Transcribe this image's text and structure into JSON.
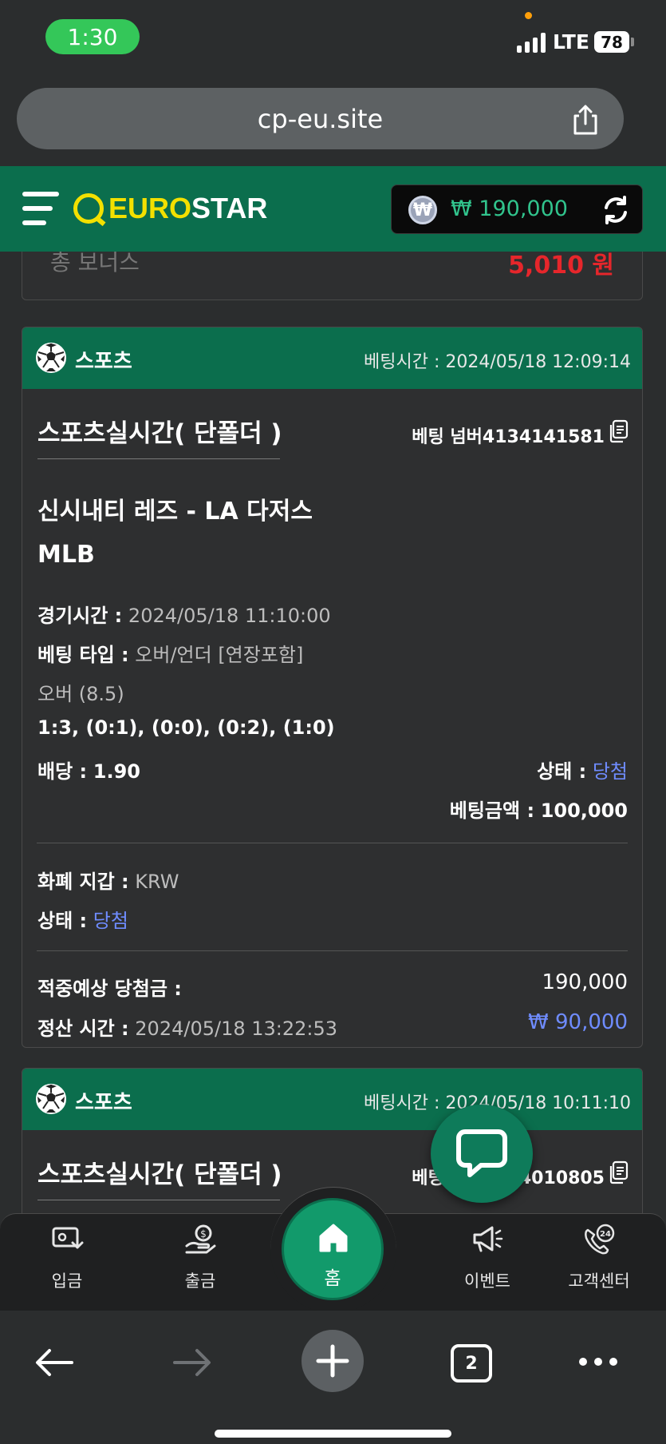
{
  "status_bar": {
    "time": "1:30",
    "network": "LTE",
    "battery": "78"
  },
  "browser": {
    "url": "cp-eu.site",
    "tab_count": "2"
  },
  "header": {
    "logo_part1": "EURO",
    "logo_part2": "STAR",
    "balance": "₩ 190,000",
    "coin_symbol": "₩"
  },
  "partial_card": {
    "label": "총 보너스",
    "value": "5,010 원"
  },
  "cards": [
    {
      "category": "스포츠",
      "bet_time": "베팅시간 : 2024/05/18 12:09:14",
      "bet_type": "스포츠실시간( 단폴더 )",
      "bet_number": "베팅 넘버4134141581",
      "match": "신시내티 레즈 - LA 다저스",
      "league": "MLB",
      "game_time_label": "경기시간 :",
      "game_time": "2024/05/18 11:10:00",
      "market_label": "베팅 타입 :",
      "market": "오버/언더 [연장포함]",
      "selection": "오버 (8.5)",
      "score": "1:3, (0:1), (0:0), (0:2), (1:0)",
      "odds_label": "배당 :",
      "odds": "1.90",
      "status_label": "상태 :",
      "status": "당첨",
      "amount_label": "베팅금액 :",
      "amount": "100,000",
      "currency_label": "화폐 지갑 :",
      "currency": "KRW",
      "status2_label": "상태 :",
      "status2": "당첨",
      "expected_label": "적중예상 당첨금 :",
      "expected": "190,000",
      "settle_label": "정산 시간 :",
      "settle_time": "2024/05/18 13:22:53",
      "profit": "₩ 90,000"
    },
    {
      "category": "스포츠",
      "bet_time": "베팅시간 : 2024/05/18 10:11:10",
      "bet_type": "스포츠실시간( 단폴더 )",
      "bet_number": "베팅 넘버4134010805"
    }
  ],
  "bottom_nav": {
    "deposit": "입금",
    "withdraw": "출금",
    "home": "홈",
    "event": "이벤트",
    "support": "고객센터",
    "support_badge": "24"
  },
  "colors": {
    "brand_green": "#0b6e4d",
    "win_blue": "#6f8cff",
    "balance_green": "#31c48d",
    "logo_yellow": "#f3e000"
  }
}
